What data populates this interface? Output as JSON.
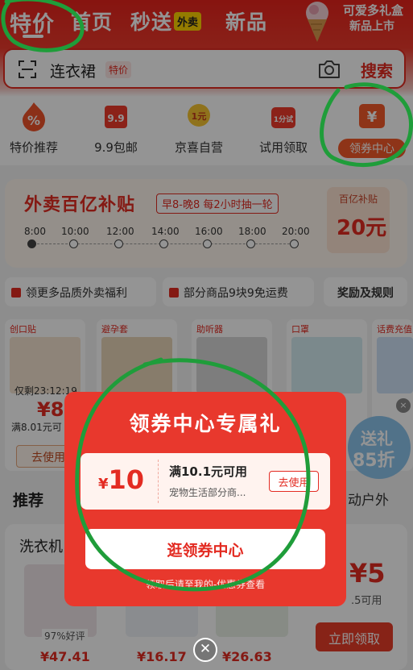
{
  "header": {
    "tabs": [
      {
        "label": "特价"
      },
      {
        "label": "首页"
      },
      {
        "label": "秒送"
      },
      {
        "label": "新品"
      }
    ],
    "waimai_badge": "外卖",
    "promo_line1": "可爱多礼盒",
    "promo_line2": "新品上市"
  },
  "search": {
    "query": "连衣裙",
    "tag": "特价",
    "button": "搜索"
  },
  "quick_links": [
    {
      "label": "特价推荐",
      "icon": "percent-flame-icon"
    },
    {
      "label": "9.9包邮",
      "icon": "9.9-badge-icon"
    },
    {
      "label": "京喜自营",
      "icon": "1yuan-medal-icon"
    },
    {
      "label": "试用领取",
      "icon": "1fen-trial-icon"
    },
    {
      "label": "领券中心",
      "icon": "yen-ticket-icon"
    }
  ],
  "icon_text": {
    "ninenine": "9.9",
    "oneyuan": "1元",
    "onefen": "1分试",
    "yen": "¥"
  },
  "waimai": {
    "title": "外卖百亿补贴",
    "subtitle": "早8-晚8 每2小时抽一轮",
    "times": [
      "8:00",
      "10:00",
      "12:00",
      "14:00",
      "16:00",
      "18:00",
      "20:00"
    ],
    "coupon_caption": "百亿补贴",
    "coupon_value": "20元"
  },
  "pills": [
    {
      "label": "领更多品质外卖福利"
    },
    {
      "label": "部分商品9块9免运费"
    },
    {
      "label": "奖励及规则"
    }
  ],
  "products": [
    {
      "tag": "创口贴",
      "time": "仅剩23:12:19",
      "price": "¥8",
      "threshold": "满8.01元可",
      "cta": "去使用"
    },
    {
      "tag": "避孕套"
    },
    {
      "tag": "助听器"
    },
    {
      "tag": "口罩"
    },
    {
      "tag": "话费充值"
    }
  ],
  "section": {
    "title": "推荐",
    "right": "动户外"
  },
  "recommend": {
    "title": "洗衣机",
    "rate": "97%好评",
    "prices": [
      "¥47.41",
      "¥16.17",
      "¥26.63"
    ],
    "right_price": "¥5",
    "right_sub": ".5可用",
    "claim": "立即领取"
  },
  "float_badge": {
    "line1": "送礼",
    "line2": "85折"
  },
  "modal": {
    "title": "领券中心专属礼",
    "coupon_yen": "¥",
    "coupon_amount": "10",
    "coupon_condition": "满10.1元可用",
    "coupon_desc": "宠物生活部分商...",
    "coupon_cta": "去使用",
    "main_cta": "逛领券中心",
    "hint": "领取后请至我的-优惠券查看"
  },
  "close_symbol": "✕",
  "float_close_symbol": "×",
  "colors": {
    "brand_red": "#e32b22",
    "annotation_green": "#1f9d3a"
  }
}
